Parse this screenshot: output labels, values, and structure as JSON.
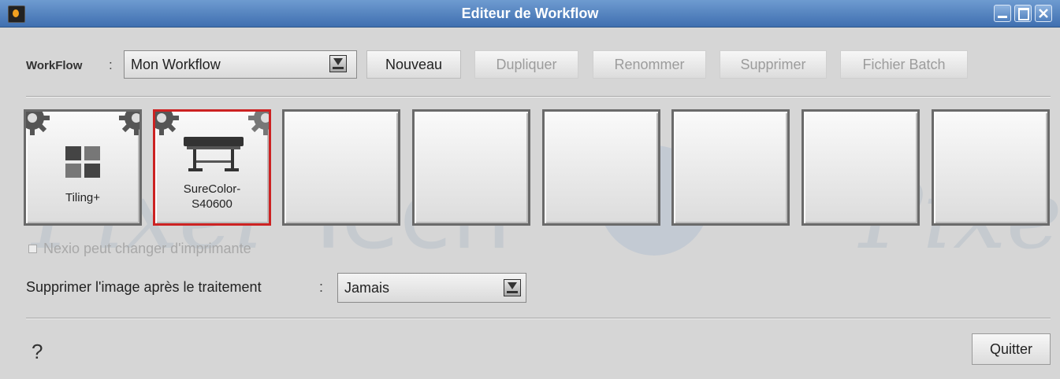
{
  "window": {
    "title": "Editeur de Workflow",
    "controls": [
      "minimize-icon",
      "maximize-icon",
      "close-icon"
    ],
    "title_bar_color": "#4a7cbf"
  },
  "toolbar": {
    "workflow_label": "WorkFlow",
    "colon": ":",
    "workflow_value": "Mon Workflow",
    "buttons": {
      "new": "Nouveau",
      "duplicate": "Dupliquer",
      "rename": "Renommer",
      "delete": "Supprimer",
      "batch": "Fichier Batch"
    }
  },
  "slots": [
    {
      "label": "Tiling+",
      "icon": "tiling-icon"
    },
    {
      "label_line1": "SureColor-",
      "label_line2": "S40600",
      "icon": "printer-icon",
      "selected": true
    },
    {},
    {},
    {},
    {},
    {},
    {}
  ],
  "options": {
    "printer_change_label": "Nexio peut changer d'imprimante",
    "printer_change_checked": false,
    "delete_image_label": "Supprimer l'image après le traitement",
    "colon": ":",
    "delete_image_value": "Jamais"
  },
  "footer": {
    "help": "?",
    "quit": "Quitter"
  },
  "colors": {
    "selected_border": "#cc2222",
    "disabled_text": "#9c9c9c"
  },
  "watermark": {
    "left": "Pixel",
    "middle": "Tech",
    "right": "Pixe"
  }
}
